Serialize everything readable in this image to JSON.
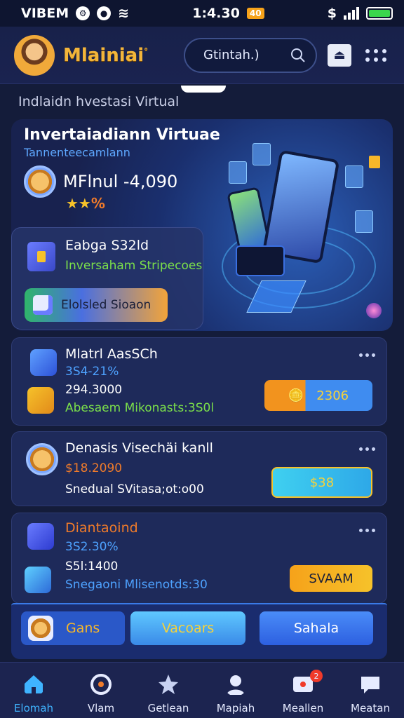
{
  "status_bar": {
    "carrier": "VIBEM",
    "time": "1:4.30",
    "time_badge": "40",
    "right_icon": "$"
  },
  "header": {
    "brand": "Mlainiai",
    "brand_mark": "°",
    "search_text": "Gtintah.)",
    "icons": [
      "avatar",
      "search-icon",
      "upload-icon",
      "grid-menu-icon"
    ]
  },
  "section": {
    "title": "Indlaidn hvestasi Virtual"
  },
  "hero": {
    "title": "Invertaiadiann Virtuae",
    "subtitle": "Tannenteecamlann",
    "balance": "MFlnul -4,090",
    "stars": "★★",
    "stars_extra": "%",
    "card": {
      "title": "Eabga S32ld",
      "subtitle": "Inversaham Stripecoes",
      "cta_label": "Elolsled Sioaon"
    }
  },
  "cards": [
    {
      "title": "Mlatrl AasSCh",
      "line1": "3S4-21%",
      "line2": "294.3000",
      "line3": "Abesaem Mikonasts:3S0l",
      "button": "2306"
    },
    {
      "title": "Denasis Visechäi kanll",
      "line1": "$18.2090",
      "line3": "Snedual SVitasa;ot:o00",
      "button": "$38"
    },
    {
      "title": "Diantaoind",
      "line1": "3S2.30%",
      "line2": "S5l:1400",
      "line3": "Snegaoni Mlisenotds:30",
      "button": "SVAAM"
    }
  ],
  "quick_actions": [
    "Gans",
    "Vacoars",
    "Sahala"
  ],
  "bottom_nav": [
    {
      "label": "Elomah",
      "icon": "home-icon",
      "active": true
    },
    {
      "label": "Vlam",
      "icon": "target-icon",
      "active": false
    },
    {
      "label": "Getlean",
      "icon": "star-icon",
      "active": false
    },
    {
      "label": "Mapiah",
      "icon": "profile-icon",
      "active": false
    },
    {
      "label": "Meallen",
      "icon": "message-icon",
      "active": false,
      "badge": "2"
    },
    {
      "label": "Meatan",
      "icon": "chat-icon",
      "active": false
    }
  ],
  "colors": {
    "background": "#141c3a",
    "accent_blue": "#3fb4ff",
    "gold": "#f3b53a",
    "green": "#7be04a",
    "orange": "#f07b2a"
  }
}
